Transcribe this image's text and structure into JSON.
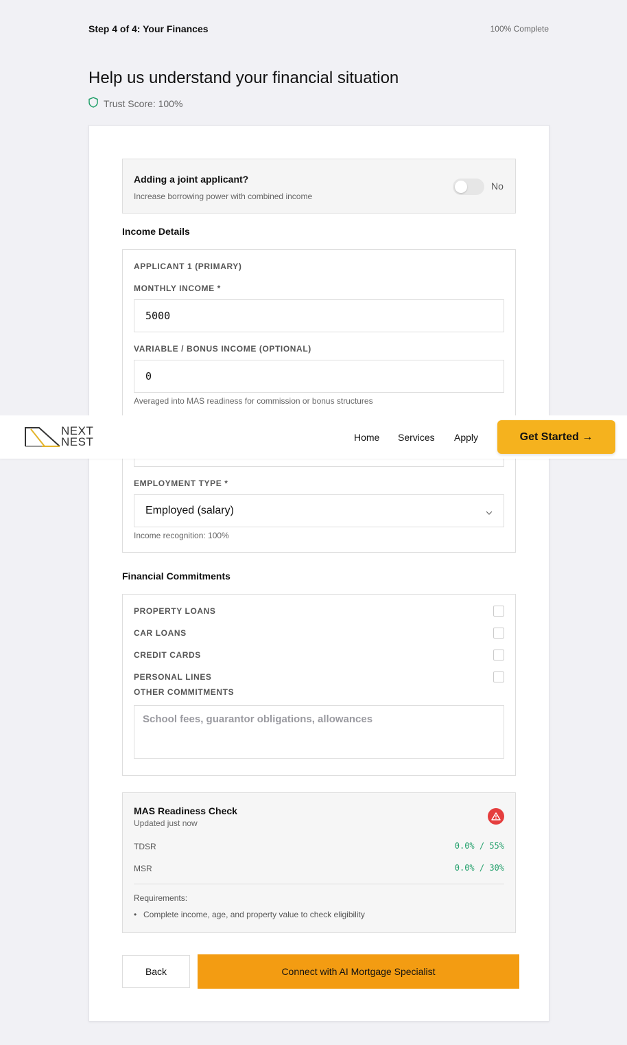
{
  "progress": {
    "step_label": "Step 4 of 4: Your Finances",
    "percent_label": "100% Complete"
  },
  "page": {
    "title": "Help us understand your financial situation",
    "trust_score": "Trust Score: 100%"
  },
  "joint_applicant": {
    "title": "Adding a joint applicant?",
    "subtitle": "Increase borrowing power with combined income",
    "toggle_value": "No",
    "enabled": false
  },
  "income": {
    "section_title": "Income Details",
    "applicant_label": "APPLICANT 1 (PRIMARY)",
    "monthly_income_label": "MONTHLY INCOME *",
    "monthly_income_value": "5000",
    "variable_income_label": "VARIABLE / BONUS INCOME (OPTIONAL)",
    "variable_income_value": "0",
    "variable_income_help": "Averaged into MAS readiness for commission or bonus structures",
    "employment_type_label": "EMPLOYMENT TYPE *",
    "employment_type_value": "Employed (salary)",
    "income_recognition": "Income recognition: 100%"
  },
  "commitments": {
    "section_title": "Financial Commitments",
    "items": [
      {
        "label": "PROPERTY LOANS",
        "checked": false
      },
      {
        "label": "CAR LOANS",
        "checked": false
      },
      {
        "label": "CREDIT CARDS",
        "checked": false
      },
      {
        "label": "PERSONAL LINES",
        "checked": false
      }
    ],
    "other_label": "OTHER COMMITMENTS",
    "other_placeholder": "School fees, guarantor obligations, allowances"
  },
  "mas": {
    "title": "MAS Readiness Check",
    "updated": "Updated just now",
    "tdsr_label": "TDSR",
    "tdsr_value": "0.0% / 55%",
    "msr_label": "MSR",
    "msr_value": "0.0% / 30%",
    "requirements_label": "Requirements:",
    "requirements": [
      "Complete income, age, and property value to check eligibility"
    ],
    "status_color": "#e53e3e",
    "ok_color": "#22a06b"
  },
  "actions": {
    "back_label": "Back",
    "connect_label": "Connect with AI Mortgage Specialist"
  },
  "navbar": {
    "logo_line1": "NEXT",
    "logo_line2": "NEST",
    "links": [
      "Home",
      "Services",
      "Apply"
    ],
    "cta_label": "Get Started →",
    "accent_color": "#f5b21e"
  }
}
